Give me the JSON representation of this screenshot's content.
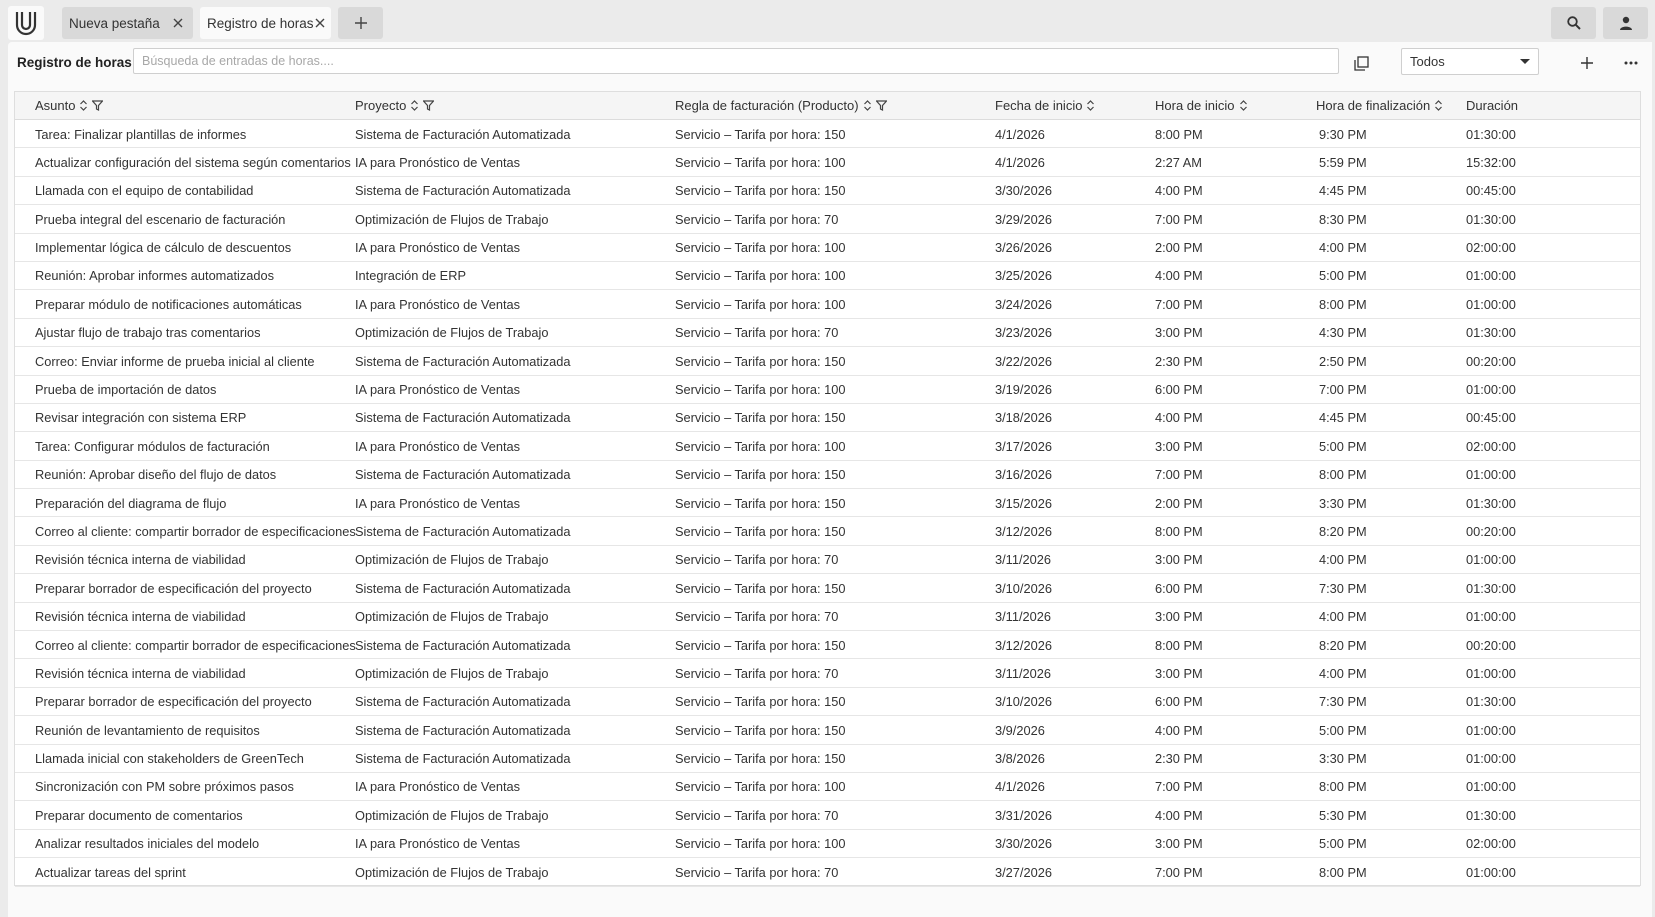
{
  "tabs": [
    {
      "label": "Nueva pestaña",
      "active": false
    },
    {
      "label": "Registro de horas",
      "active": true
    }
  ],
  "toolbar": {
    "title": "Registro de horas",
    "search_placeholder": "Búsqueda de entradas de horas....",
    "search_value": "",
    "filter_selected": "Todos"
  },
  "table": {
    "headers": [
      "Asunto",
      "Proyecto",
      "Regla de facturación (Producto)",
      "Fecha de inicio",
      "Hora de inicio",
      "Hora de finalización",
      "Duración"
    ],
    "rows": [
      [
        "Tarea: Finalizar plantillas de informes",
        "Sistema de Facturación Automatizada",
        "Servicio – Tarifa por hora: 150",
        "4/1/2026",
        "8:00 PM",
        "9:30 PM",
        "01:30:00"
      ],
      [
        "Actualizar configuración del sistema según comentarios",
        "IA para Pronóstico de Ventas",
        "Servicio – Tarifa por hora: 100",
        "4/1/2026",
        "2:27 AM",
        "5:59 PM",
        "15:32:00"
      ],
      [
        "Llamada con el equipo de contabilidad",
        "Sistema de Facturación Automatizada",
        "Servicio – Tarifa por hora: 150",
        "3/30/2026",
        "4:00 PM",
        "4:45 PM",
        "00:45:00"
      ],
      [
        "Prueba integral del escenario de facturación",
        "Optimización de Flujos de Trabajo",
        "Servicio – Tarifa por hora: 70",
        "3/29/2026",
        "7:00 PM",
        "8:30 PM",
        "01:30:00"
      ],
      [
        "Implementar lógica de cálculo de descuentos",
        "IA para Pronóstico de Ventas",
        "Servicio – Tarifa por hora: 100",
        "3/26/2026",
        "2:00 PM",
        "4:00 PM",
        "02:00:00"
      ],
      [
        "Reunión: Aprobar informes automatizados",
        "Integración de ERP",
        "Servicio – Tarifa por hora: 100",
        "3/25/2026",
        "4:00 PM",
        "5:00 PM",
        "01:00:00"
      ],
      [
        "Preparar módulo de notificaciones automáticas",
        "IA para Pronóstico de Ventas",
        "Servicio – Tarifa por hora: 100",
        "3/24/2026",
        "7:00 PM",
        "8:00 PM",
        "01:00:00"
      ],
      [
        "Ajustar flujo de trabajo tras comentarios",
        "Optimización de Flujos de Trabajo",
        "Servicio – Tarifa por hora: 70",
        "3/23/2026",
        "3:00 PM",
        "4:30 PM",
        "01:30:00"
      ],
      [
        "Correo: Enviar informe de prueba inicial al cliente",
        "Sistema de Facturación Automatizada",
        "Servicio – Tarifa por hora: 150",
        "3/22/2026",
        "2:30 PM",
        "2:50 PM",
        "00:20:00"
      ],
      [
        "Prueba de importación de datos",
        "IA para Pronóstico de Ventas",
        "Servicio – Tarifa por hora: 100",
        "3/19/2026",
        "6:00 PM",
        "7:00 PM",
        "01:00:00"
      ],
      [
        "Revisar integración con sistema ERP",
        "Sistema de Facturación Automatizada",
        "Servicio – Tarifa por hora: 150",
        "3/18/2026",
        "4:00 PM",
        "4:45 PM",
        "00:45:00"
      ],
      [
        "Tarea: Configurar módulos de facturación",
        "IA para Pronóstico de Ventas",
        "Servicio – Tarifa por hora: 100",
        "3/17/2026",
        "3:00 PM",
        "5:00 PM",
        "02:00:00"
      ],
      [
        "Reunión: Aprobar diseño del flujo de datos",
        "Sistema de Facturación Automatizada",
        "Servicio – Tarifa por hora: 150",
        "3/16/2026",
        "7:00 PM",
        "8:00 PM",
        "01:00:00"
      ],
      [
        "Preparación del diagrama de flujo",
        "IA para Pronóstico de Ventas",
        "Servicio – Tarifa por hora: 150",
        "3/15/2026",
        "2:00 PM",
        "3:30 PM",
        "01:30:00"
      ],
      [
        "Correo al cliente: compartir borrador de especificaciones",
        "Sistema de Facturación Automatizada",
        "Servicio – Tarifa por hora: 150",
        "3/12/2026",
        "8:00 PM",
        "8:20 PM",
        "00:20:00"
      ],
      [
        "Revisión técnica interna de viabilidad",
        "Optimización de Flujos de Trabajo",
        "Servicio – Tarifa por hora: 70",
        "3/11/2026",
        "3:00 PM",
        "4:00 PM",
        "01:00:00"
      ],
      [
        "Preparar borrador de especificación del proyecto",
        "Sistema de Facturación Automatizada",
        "Servicio – Tarifa por hora: 150",
        "3/10/2026",
        "6:00 PM",
        "7:30 PM",
        "01:30:00"
      ],
      [
        "Revisión técnica interna de viabilidad",
        "Optimización de Flujos de Trabajo",
        "Servicio – Tarifa por hora: 70",
        "3/11/2026",
        "3:00 PM",
        "4:00 PM",
        "01:00:00"
      ],
      [
        "Correo al cliente: compartir borrador de especificaciones",
        "Sistema de Facturación Automatizada",
        "Servicio – Tarifa por hora: 150",
        "3/12/2026",
        "8:00 PM",
        "8:20 PM",
        "00:20:00"
      ],
      [
        "Revisión técnica interna de viabilidad",
        "Optimización de Flujos de Trabajo",
        "Servicio – Tarifa por hora: 70",
        "3/11/2026",
        "3:00 PM",
        "4:00 PM",
        "01:00:00"
      ],
      [
        "Preparar borrador de especificación del proyecto",
        "Sistema de Facturación Automatizada",
        "Servicio – Tarifa por hora: 150",
        "3/10/2026",
        "6:00 PM",
        "7:30 PM",
        "01:30:00"
      ],
      [
        "Reunión de levantamiento de requisitos",
        "Sistema de Facturación Automatizada",
        "Servicio – Tarifa por hora: 150",
        "3/9/2026",
        "4:00 PM",
        "5:00 PM",
        "01:00:00"
      ],
      [
        "Llamada inicial con stakeholders de GreenTech",
        "Sistema de Facturación Automatizada",
        "Servicio – Tarifa por hora: 150",
        "3/8/2026",
        "2:30 PM",
        "3:30 PM",
        "01:00:00"
      ],
      [
        "Sincronización con PM sobre próximos pasos",
        "IA para Pronóstico de Ventas",
        "Servicio – Tarifa por hora: 100",
        "4/1/2026",
        "7:00 PM",
        "8:00 PM",
        "01:00:00"
      ],
      [
        "Preparar documento de comentarios",
        "Optimización de Flujos de Trabajo",
        "Servicio – Tarifa por hora: 70",
        "3/31/2026",
        "4:00 PM",
        "5:30 PM",
        "01:30:00"
      ],
      [
        "Analizar resultados iniciales del modelo",
        "IA para Pronóstico de Ventas",
        "Servicio – Tarifa por hora: 100",
        "3/30/2026",
        "3:00 PM",
        "5:00 PM",
        "02:00:00"
      ],
      [
        "Actualizar tareas del sprint",
        "Optimización de Flujos de Trabajo",
        "Servicio – Tarifa por hora: 70",
        "3/27/2026",
        "7:00 PM",
        "8:00 PM",
        "01:00:00"
      ]
    ]
  }
}
